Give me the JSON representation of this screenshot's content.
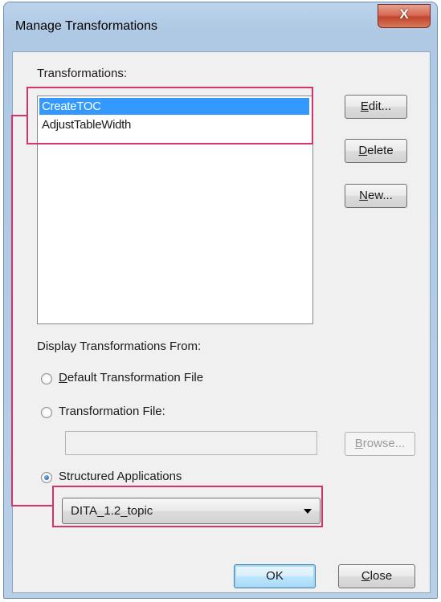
{
  "window": {
    "title": "Manage Transformations",
    "close_glyph": "X"
  },
  "transformations": {
    "label": "Transformations:",
    "items": [
      {
        "label": "CreateTOC",
        "selected": true
      },
      {
        "label": "AdjustTableWidth",
        "selected": false
      }
    ]
  },
  "buttons": {
    "edit": {
      "mnemonic": "E",
      "rest": "dit..."
    },
    "delete": {
      "mnemonic": "D",
      "rest": "elete"
    },
    "new": {
      "mnemonic": "N",
      "rest": "ew..."
    },
    "browse": {
      "mnemonic": "B",
      "rest": "rowse..."
    },
    "ok": "OK",
    "close": {
      "mnemonic": "C",
      "rest": "lose"
    }
  },
  "display_from": {
    "label": "Display Transformations From:",
    "options": [
      {
        "mnemonic": "D",
        "rest": "efault Transformation File",
        "checked": false
      },
      {
        "mnemonic": "",
        "rest": "Transformation File:",
        "checked": false
      },
      {
        "mnemonic": "",
        "rest": "Structured Applications",
        "checked": true
      }
    ],
    "file_path_value": "",
    "structured_app_selected": "DITA_1.2_topic"
  },
  "colors": {
    "highlight": "#d6336c",
    "selection": "#3399ff"
  }
}
